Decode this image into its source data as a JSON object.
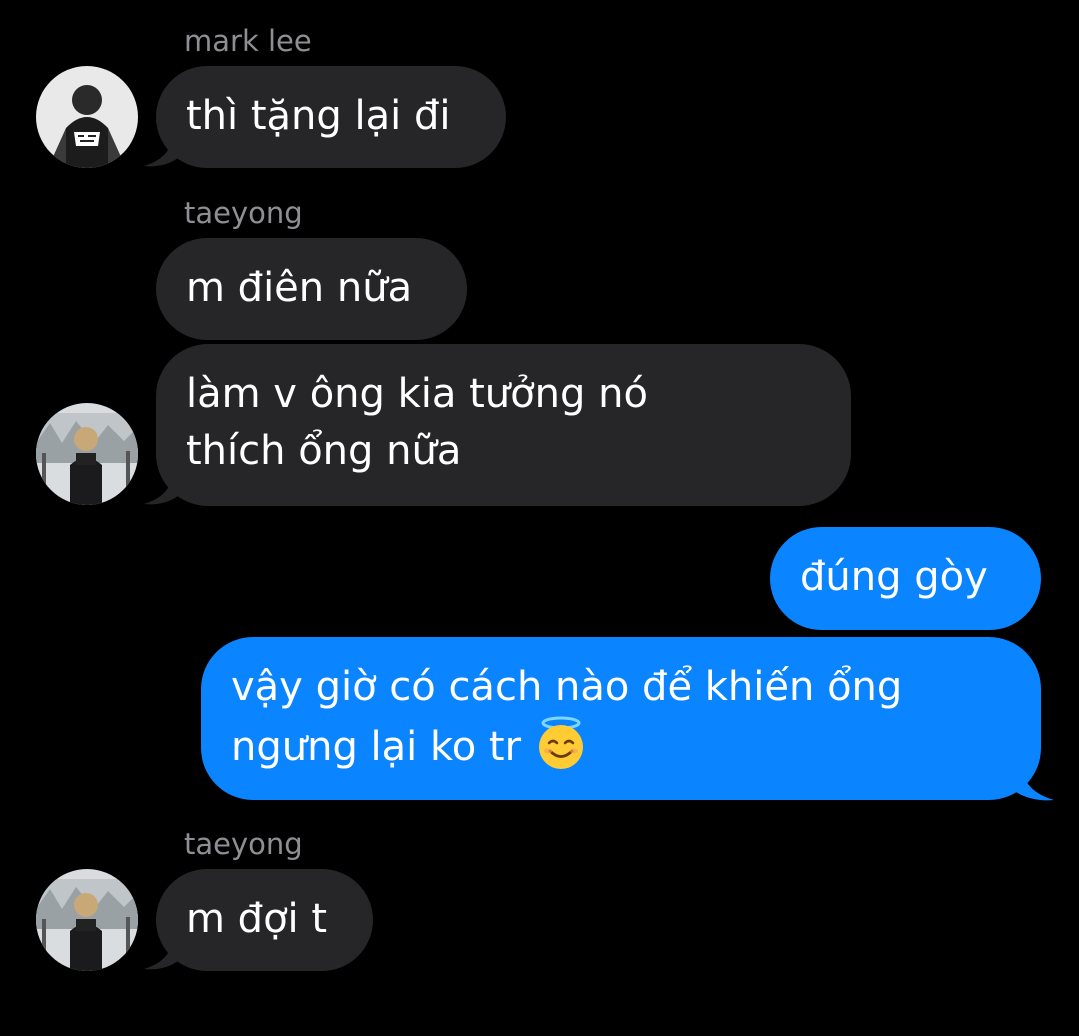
{
  "conversation": {
    "messages": [
      {
        "sender": "mark lee",
        "direction": "incoming",
        "avatar": "mark-lee-avatar",
        "lines": [
          "thì tặng lại đi"
        ]
      },
      {
        "sender": "taeyong",
        "direction": "incoming",
        "avatar": null,
        "lines": [
          "m điên nữa"
        ]
      },
      {
        "sender": null,
        "direction": "incoming",
        "avatar": "taeyong-avatar",
        "lines": [
          "làm v ông kia tưởng nó",
          "thích ổng nữa"
        ]
      },
      {
        "sender": null,
        "direction": "outgoing",
        "lines": [
          "đúng gòy"
        ]
      },
      {
        "sender": null,
        "direction": "outgoing",
        "lines": [
          "vậy giờ có cách nào để khiến ổng",
          "ngưng lại ko tr"
        ],
        "trailing_emoji": "smiling-face-with-halo-emoji"
      },
      {
        "sender": "taeyong",
        "direction": "incoming",
        "avatar": "taeyong-avatar",
        "lines": [
          "m đợi t"
        ]
      }
    ]
  },
  "colors": {
    "background": "#000000",
    "incoming_bubble": "#262628",
    "outgoing_bubble": "#0a84ff",
    "sender_name": "#8e8e93",
    "text": "#ffffff"
  }
}
